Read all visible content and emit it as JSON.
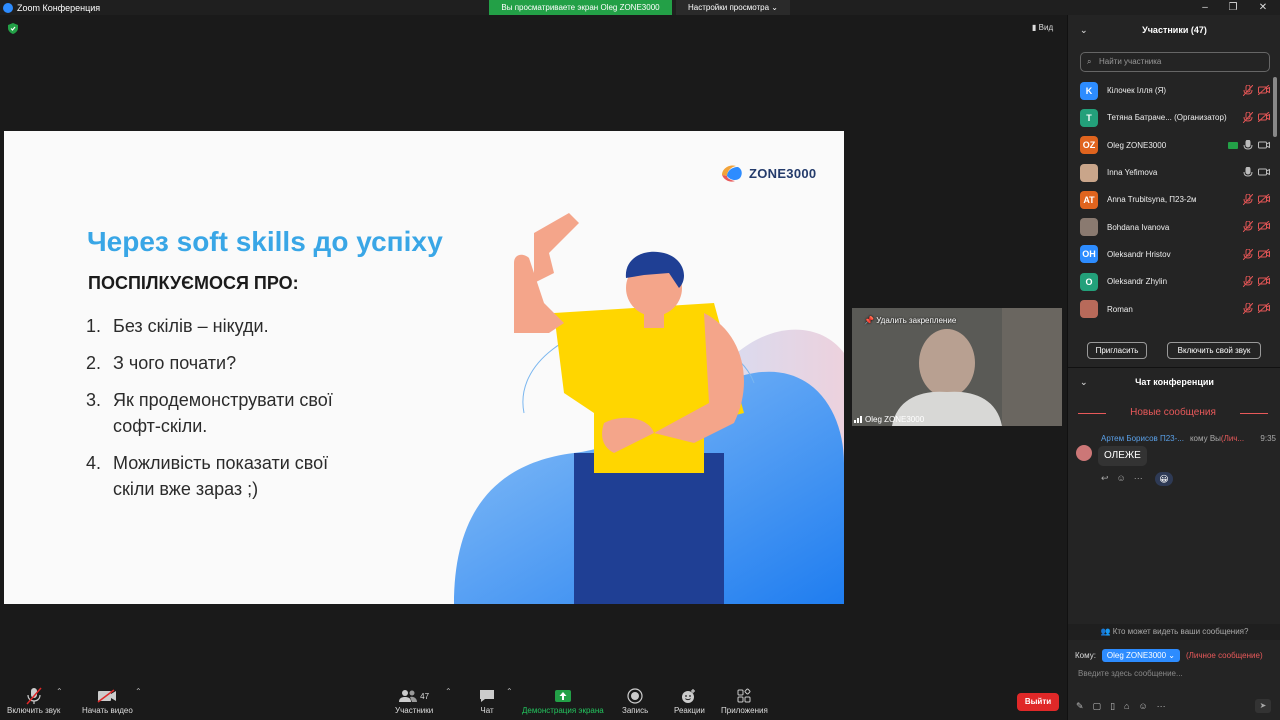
{
  "window": {
    "title": "Zoom Конференция",
    "minimize": "–",
    "restore": "❐",
    "close": "✕"
  },
  "share_banner": "Вы просматриваете экран Oleg ZONE3000",
  "view_settings": "Настройки просмотра",
  "view_button": "Вид",
  "slide": {
    "logo_text": "ZONE3000",
    "title": "Через soft skills до успіху",
    "subtitle": "ПОСПІЛКУЄМОСЯ ПРО:",
    "items": [
      {
        "num": "1.",
        "text": "Без скілів – нікуди."
      },
      {
        "num": "2.",
        "text": "З чого почати?"
      },
      {
        "num": "3.",
        "text": "Як продемонструвати свої софт-скіли."
      },
      {
        "num": "4.",
        "text": "Можливість показати свої скіли вже зараз ;)"
      }
    ]
  },
  "pinned_video": {
    "pin_label": "Удалить закрепление",
    "name": "Oleg ZONE3000"
  },
  "toolbar": {
    "unmute": "Включить звук",
    "start_video": "Начать видео",
    "participants": "Участники",
    "participants_count": "47",
    "chat": "Чат",
    "share_screen": "Демонстрация экрана",
    "record": "Запись",
    "reactions": "Реакции",
    "apps": "Приложения",
    "leave": "Выйти"
  },
  "participants_panel": {
    "title": "Участники (47)",
    "search_placeholder": "Найти участника",
    "participants": [
      {
        "initials": "K",
        "color": "#2d8cff",
        "name": "Кілочек Ілля (Я)"
      },
      {
        "initials": "T",
        "color": "#23a07a",
        "name": "Тетяна Батраче... (Организатор)"
      },
      {
        "initials": "OZ",
        "color": "#e0641e",
        "name": "Oleg ZONE3000"
      },
      {
        "initials": "",
        "color": "#c9a58a",
        "name": "Inna Yefimova"
      },
      {
        "initials": "AT",
        "color": "#e0641e",
        "name": "Anna Trubitsyna, П23-2м"
      },
      {
        "initials": "",
        "color": "#8a7a70",
        "name": "Bohdana Ivanova"
      },
      {
        "initials": "OH",
        "color": "#2d8cff",
        "name": "Oleksandr Hristov"
      },
      {
        "initials": "O",
        "color": "#23a07a",
        "name": "Oleksandr Zhylin"
      },
      {
        "initials": "",
        "color": "#b86a5a",
        "name": "Roman"
      }
    ],
    "invite_button": "Пригласить",
    "unmute_button": "Включить свой звук"
  },
  "chat_panel": {
    "title": "Чат конференции",
    "new_messages": "Новые сообщения",
    "message": {
      "sender": "Артем Борисов П23-...",
      "to": "кому Вы",
      "private": "(Лич...",
      "time": "9:35",
      "text": "ОЛЕЖЕ",
      "emoji": "😀"
    },
    "who_can_see": "Кто может видеть ваши сообщения?",
    "to_label": "Кому:",
    "recipient": "Oleg ZONE3000 ⌄",
    "private_label": "(Личное сообщение)",
    "input_placeholder": "Введите здесь сообщение..."
  },
  "colors": {
    "accent_blue": "#2d8cff",
    "share_green": "#23a047",
    "leave_red": "#e02828",
    "slide_title": "#39a6e6"
  }
}
